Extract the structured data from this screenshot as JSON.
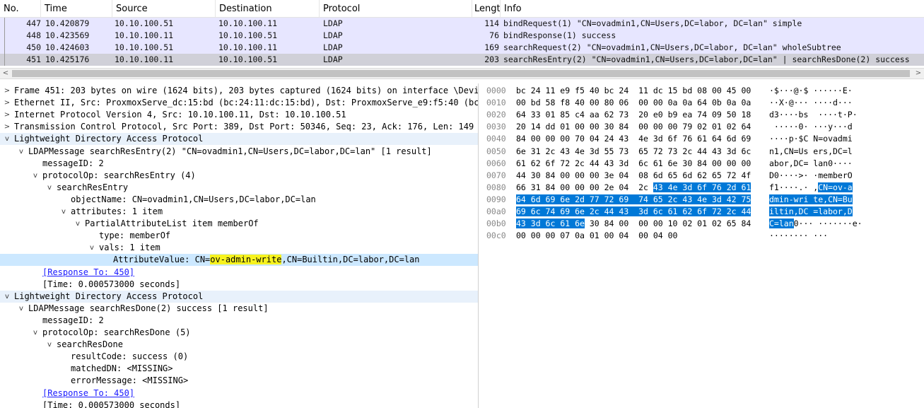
{
  "packet_list": {
    "columns": [
      "No.",
      "Time",
      "Source",
      "Destination",
      "Protocol",
      "Lengtl",
      "Info"
    ],
    "rows": [
      {
        "no": "447",
        "time": "10.420879",
        "src": "10.10.100.51",
        "dst": "10.10.100.11",
        "proto": "LDAP",
        "len": "114",
        "info": "bindRequest(1) \"CN=ovadmin1,CN=Users,DC=labor, DC=lan\" simple"
      },
      {
        "no": "448",
        "time": "10.423569",
        "src": "10.10.100.11",
        "dst": "10.10.100.51",
        "proto": "LDAP",
        "len": "76",
        "info": "bindResponse(1) success"
      },
      {
        "no": "450",
        "time": "10.424603",
        "src": "10.10.100.51",
        "dst": "10.10.100.11",
        "proto": "LDAP",
        "len": "169",
        "info": "searchRequest(2) \"CN=ovadmin1,CN=Users,DC=labor, DC=lan\" wholeSubtree"
      },
      {
        "no": "451",
        "time": "10.425176",
        "src": "10.10.100.11",
        "dst": "10.10.100.51",
        "proto": "LDAP",
        "len": "203",
        "info": "searchResEntry(2) \"CN=ovadmin1,CN=Users,DC=labor,DC=lan\"  | searchResDone(2) success"
      }
    ]
  },
  "scrollbar": {
    "left_arrow": "<",
    "right_arrow": ">"
  },
  "details": {
    "rows": [
      {
        "text": "Frame 451: 203 bytes on wire (1624 bits), 203 bytes captured (1624 bits) on interface \\Device\\",
        "tw": ">"
      },
      {
        "text": "Ethernet II, Src: ProxmoxServe_dc:15:bd (bc:24:11:dc:15:bd), Dst: ProxmoxServe_e9:f5:40 (bc:24",
        "tw": ">"
      },
      {
        "text": "Internet Protocol Version 4, Src: 10.10.100.11, Dst: 10.10.100.51",
        "tw": ">"
      },
      {
        "text": "Transmission Control Protocol, Src Port: 389, Dst Port: 50346, Seq: 23, Ack: 176, Len: 149",
        "tw": ">"
      },
      {
        "text": "Lightweight Directory Access Protocol",
        "tw": "v"
      },
      {
        "text": "LDAPMessage searchResEntry(2) \"CN=ovadmin1,CN=Users,DC=labor,DC=lan\" [1 result]",
        "tw": "v"
      },
      {
        "text": "messageID: 2",
        "tw": ""
      },
      {
        "text": "protocolOp: searchResEntry (4)",
        "tw": "v"
      },
      {
        "text": "searchResEntry",
        "tw": "v"
      },
      {
        "text": "objectName: CN=ovadmin1,CN=Users,DC=labor,DC=lan",
        "tw": ""
      },
      {
        "text": "attributes: 1 item",
        "tw": "v"
      },
      {
        "text": "PartialAttributeList item memberOf",
        "tw": "v"
      },
      {
        "text": "type: memberOf",
        "tw": ""
      },
      {
        "text": "vals: 1 item",
        "tw": "v"
      },
      {
        "prefix": "AttributeValue: CN=",
        "marked": "ov-admin-write",
        "suffix": ",CN=Builtin,DC=labor,DC=lan",
        "tw": ""
      },
      {
        "text": "[Response To: 450]",
        "tw": ""
      },
      {
        "text": "[Time: 0.000573000 seconds]",
        "tw": ""
      },
      {
        "text": "Lightweight Directory Access Protocol",
        "tw": "v"
      },
      {
        "text": "LDAPMessage searchResDone(2) success [1 result]",
        "tw": "v"
      },
      {
        "text": "messageID: 2",
        "tw": ""
      },
      {
        "text": "protocolOp: searchResDone (5)",
        "tw": "v"
      },
      {
        "text": "searchResDone",
        "tw": "v"
      },
      {
        "text": "resultCode: success (0)",
        "tw": ""
      },
      {
        "text": "matchedDN: <MISSING>",
        "tw": ""
      },
      {
        "text": "errorMessage: <MISSING>",
        "tw": ""
      },
      {
        "text": "[Response To: 450]",
        "tw": ""
      },
      {
        "text": "[Time: 0.000573000 seconds]",
        "tw": ""
      }
    ]
  },
  "bytes": {
    "rows": [
      {
        "offset": "0000",
        "hex": [
          [
            "bc 24 11 e9 f5 40 bc 24  11 dc 15 bd 08 00 45 00",
            ""
          ]
        ],
        "ascii": [
          [
            "·$···@·$ ······E·",
            ""
          ]
        ]
      },
      {
        "offset": "0010",
        "hex": [
          [
            "00 bd 58 f8 40 00 80 06  00 00 0a 0a 64 0b 0a 0a",
            ""
          ]
        ],
        "ascii": [
          [
            "··X·@··· ····d···",
            ""
          ]
        ]
      },
      {
        "offset": "0020",
        "hex": [
          [
            "64 33 01 85 c4 aa 62 73  20 e0 b9 ea 74 09 50 18",
            ""
          ]
        ],
        "ascii": [
          [
            "d3····bs  ····t·P·",
            ""
          ]
        ]
      },
      {
        "offset": "0030",
        "hex": [
          [
            "20 14 dd 01 00 00 30 84  00 00 00 79 02 01 02 64",
            ""
          ]
        ],
        "ascii": [
          [
            " ·····0· ···y···d",
            ""
          ]
        ]
      },
      {
        "offset": "0040",
        "hex": [
          [
            "84 00 00 00 70 04 24 43  4e 3d 6f 76 61 64 6d 69",
            ""
          ]
        ],
        "ascii": [
          [
            "····p·$C N=ovadmi",
            ""
          ]
        ]
      },
      {
        "offset": "0050",
        "hex": [
          [
            "6e 31 2c 43 4e 3d 55 73  65 72 73 2c 44 43 3d 6c",
            ""
          ]
        ],
        "ascii": [
          [
            "n1,CN=Us ers,DC=l",
            ""
          ]
        ]
      },
      {
        "offset": "0060",
        "hex": [
          [
            "61 62 6f 72 2c 44 43 3d  6c 61 6e 30 84 00 00 00",
            ""
          ]
        ],
        "ascii": [
          [
            "abor,DC= lan0····",
            ""
          ]
        ]
      },
      {
        "offset": "0070",
        "hex": [
          [
            "44 30 84 00 00 00 3e 04  08 6d 65 6d 62 65 72 4f",
            ""
          ]
        ],
        "ascii": [
          [
            "D0····>· ·memberO",
            ""
          ]
        ]
      },
      {
        "offset": "0080",
        "hex": [
          [
            "66 31 84 00 00 00 2e 04  2c ",
            ""
          ],
          [
            "43 4e 3d 6f 76 2d 61",
            "sel"
          ]
        ],
        "ascii": [
          [
            "f1····.· ,",
            ""
          ],
          [
            "CN=ov-a",
            "sel"
          ]
        ]
      },
      {
        "offset": "0090",
        "hex": [
          [
            "64 6d 69 6e 2d 77 72 69  74 65 2c 43 4e 3d 42 75",
            "sel"
          ]
        ],
        "ascii": [
          [
            "dmin-wri te,CN=Bu",
            "sel"
          ]
        ]
      },
      {
        "offset": "00a0",
        "hex": [
          [
            "69 6c 74 69 6e 2c 44 43  3d 6c 61 62 6f 72 2c 44",
            "sel"
          ]
        ],
        "ascii": [
          [
            "iltin,DC =labor,D",
            "sel"
          ]
        ]
      },
      {
        "offset": "00b0",
        "hex": [
          [
            "43 3d 6c 61 6e",
            "sel"
          ],
          [
            " 30 84 00  00 00 10 02 01 02 65 84",
            ""
          ]
        ],
        "ascii": [
          [
            "C=lan",
            "sel"
          ],
          [
            "0··· ·······e·",
            ""
          ]
        ]
      },
      {
        "offset": "00c0",
        "hex": [
          [
            "00 00 00 07 0a 01 00 04  00 04 00",
            ""
          ]
        ],
        "ascii": [
          [
            "········ ···",
            ""
          ]
        ]
      }
    ]
  }
}
